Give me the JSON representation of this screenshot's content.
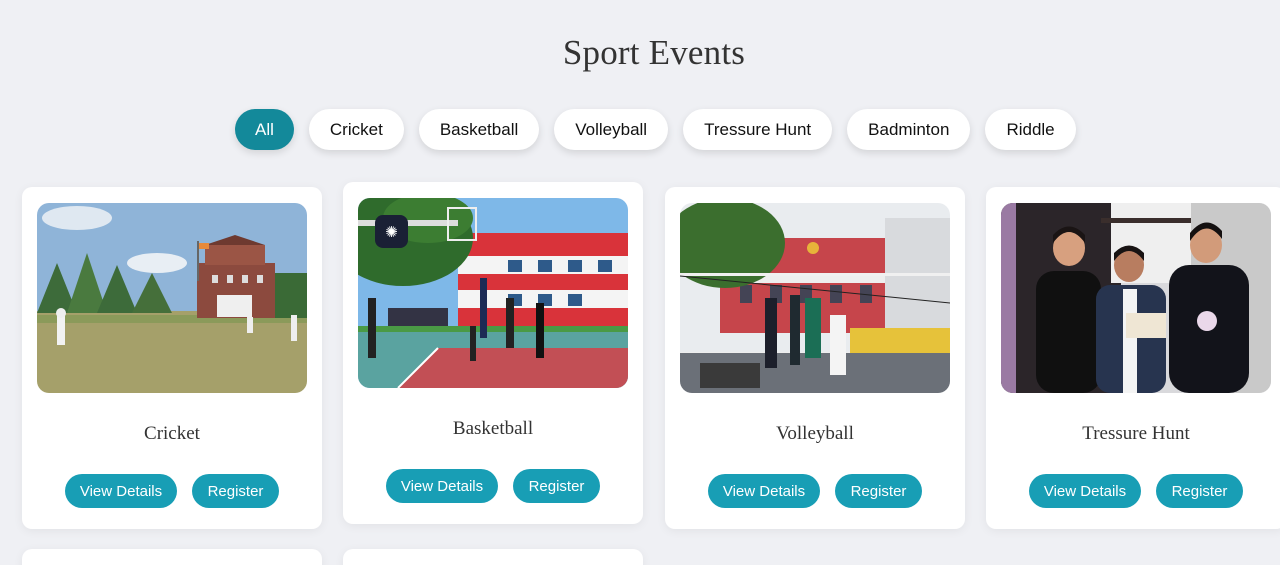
{
  "page": {
    "title": "Sport Events"
  },
  "filters": [
    "All",
    "Cricket",
    "Basketball",
    "Volleyball",
    "Tressure Hunt",
    "Badminton",
    "Riddle"
  ],
  "active_filter": "All",
  "cards": [
    {
      "title": "Cricket",
      "details_label": "View Details",
      "register_label": "Register"
    },
    {
      "title": "Basketball",
      "details_label": "View Details",
      "register_label": "Register"
    },
    {
      "title": "Volleyball",
      "details_label": "View Details",
      "register_label": "Register"
    },
    {
      "title": "Tressure Hunt",
      "details_label": "View Details",
      "register_label": "Register"
    }
  ],
  "colors": {
    "accent": "#13899a",
    "button": "#189eb5",
    "background": "#eff0f4"
  }
}
